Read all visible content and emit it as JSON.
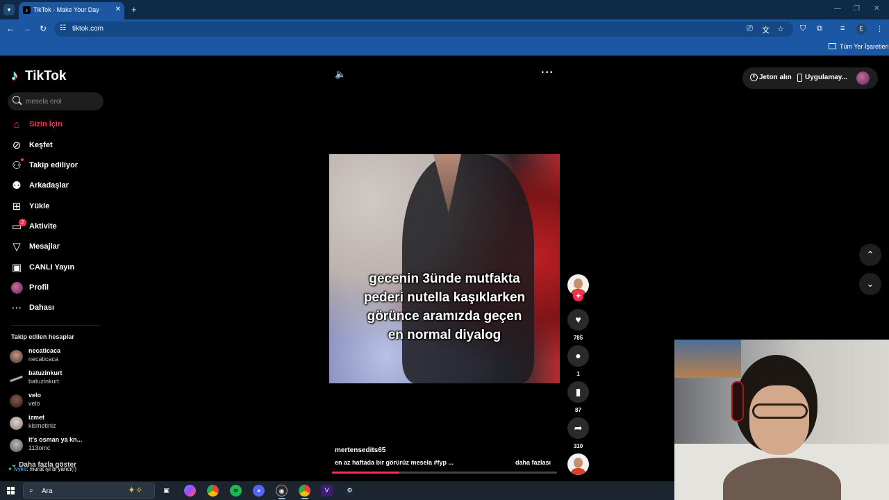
{
  "browser": {
    "tab_title": "TikTok - Make Your Day",
    "url": "tiktok.com",
    "bookmarks_label": "Tüm Yer İşaretleri",
    "profile_letter": "E"
  },
  "sidebar": {
    "logo": "TikTok",
    "search_placeholder": "mesela erol",
    "menu": [
      {
        "label": "Sizin İçin",
        "icon": "home-icon",
        "active": true
      },
      {
        "label": "Keşfet",
        "icon": "compass-icon"
      },
      {
        "label": "Takip ediliyor",
        "icon": "user-follow-icon"
      },
      {
        "label": "Arkadaşlar",
        "icon": "friends-icon"
      },
      {
        "label": "Yükle",
        "icon": "upload-icon"
      },
      {
        "label": "Aktivite",
        "icon": "activity-icon",
        "badge": "2"
      },
      {
        "label": "Mesajlar",
        "icon": "messages-icon"
      },
      {
        "label": "CANLI Yayın",
        "icon": "live-icon"
      },
      {
        "label": "Profil",
        "icon": "profile-avatar"
      },
      {
        "label": "Dahası",
        "icon": "more-icon"
      }
    ],
    "followed_title": "Takip edilen hesaplar",
    "followed": [
      {
        "name": "necaticaca",
        "sub": "necaticaca"
      },
      {
        "name": "batuzinkurt",
        "sub": "batuzinkurt"
      },
      {
        "name": "velo",
        "sub": "velo"
      },
      {
        "name": "izmet",
        "sub": "kismetiniz"
      },
      {
        "name": "it's osman ya kn...",
        "sub": "113omc"
      }
    ],
    "more_accounts": "Daha fazla göster",
    "chat_user": "ivyke",
    "chat_message": ": murat iyi bi yancı(!)"
  },
  "video": {
    "caption_lines": [
      "gecenin 3ünde mutfakta",
      "pederi nutella kaşıklarken",
      "görünce aramızda geçen",
      "en normal diyalog"
    ],
    "author": "mertensedits65",
    "description": "en az haftada bir görürüz mesela #fyp  ...",
    "more_label": "daha fazlası",
    "progress": 0.3
  },
  "actions": {
    "likes": "785",
    "comments": "1",
    "saves": "87",
    "shares": "310"
  },
  "topright": {
    "coins_label": "Jeton alın",
    "app_label": "Uygulamay..."
  },
  "taskbar": {
    "search_label": "Ara"
  },
  "colors": {
    "tiktok_pink": "#fe2c55",
    "browser_blue": "#1b57a3"
  }
}
